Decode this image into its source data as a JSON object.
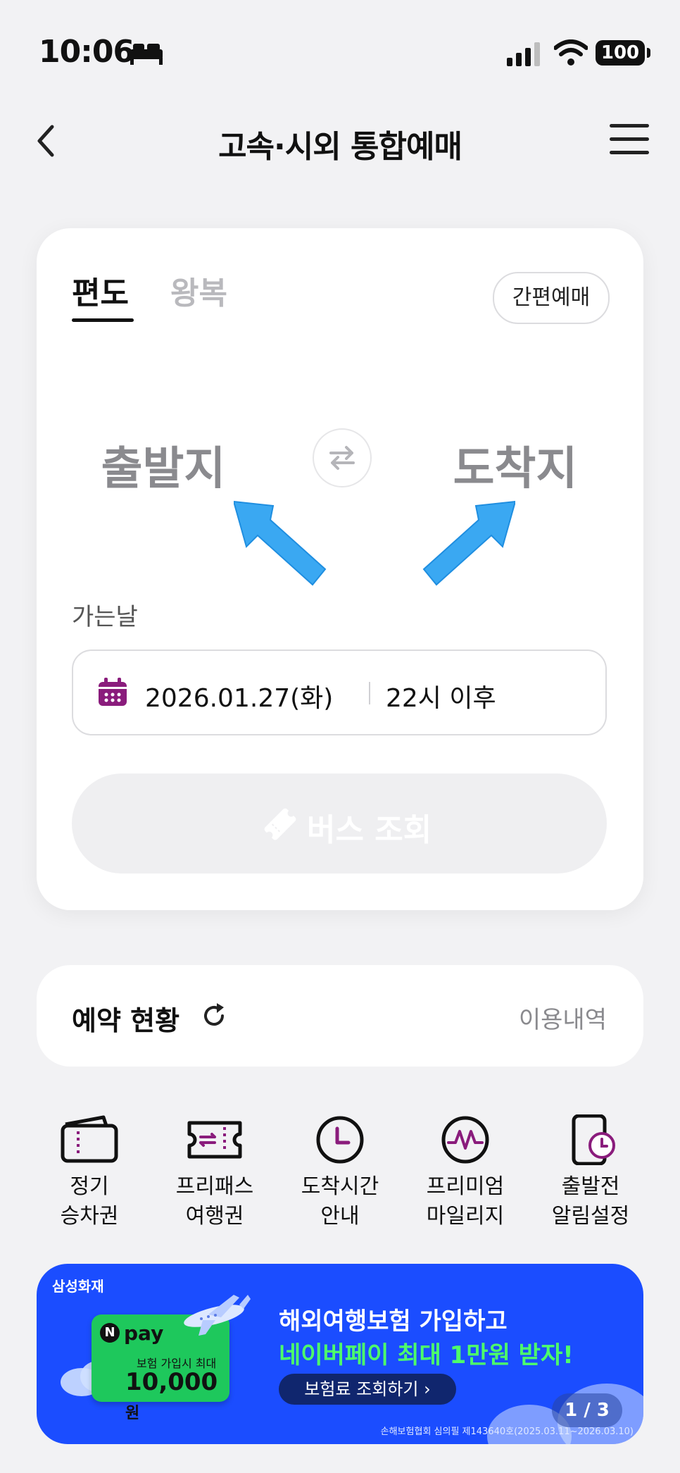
{
  "status_bar": {
    "time": "10:06",
    "battery": "100"
  },
  "header": {
    "title": "고속·시외 통합예매"
  },
  "booking": {
    "tabs": [
      "편도",
      "왕복"
    ],
    "selected_tab": "편도",
    "quick_booking_label": "간편예매",
    "origin_placeholder": "출발지",
    "destination_placeholder": "도착지",
    "date_label": "가는날",
    "date_value": "2026.01.27(화)",
    "time_value": "22시 이후",
    "search_label": "버스 조회"
  },
  "reservation": {
    "title": "예약 현황",
    "history_link": "이용내역"
  },
  "quick_menu": [
    {
      "line1": "정기",
      "line2": "승차권",
      "icon": "wallet-icon"
    },
    {
      "line1": "프리패스",
      "line2": "여행권",
      "icon": "ticket-pass-icon"
    },
    {
      "line1": "도착시간",
      "line2": "안내",
      "icon": "clock-icon"
    },
    {
      "line1": "프리미엄",
      "line2": "마일리지",
      "icon": "mileage-icon"
    },
    {
      "line1": "출발전",
      "line2": "알림설정",
      "icon": "phone-alarm-icon"
    }
  ],
  "banner": {
    "brand": "삼성화재",
    "npay_text": "pay",
    "npay_sub": "보험 가입시 최대",
    "npay_amount": "10,000",
    "npay_unit": "원",
    "headline": "해외여행보험 가입하고",
    "highlight": "네이버페이 최대 1만원 받자!",
    "cta": "보험료 조회하기 ›",
    "page_indicator": "1 / 3",
    "legal": "손해보험협회 심의필 제143640호(2025.03.11~2026.03.10)"
  },
  "colors": {
    "accent_purple": "#8a1c7c",
    "banner_blue": "#1b4dff",
    "highlight_green": "#4dff6a",
    "arrow_blue": "#3aa8f2"
  }
}
